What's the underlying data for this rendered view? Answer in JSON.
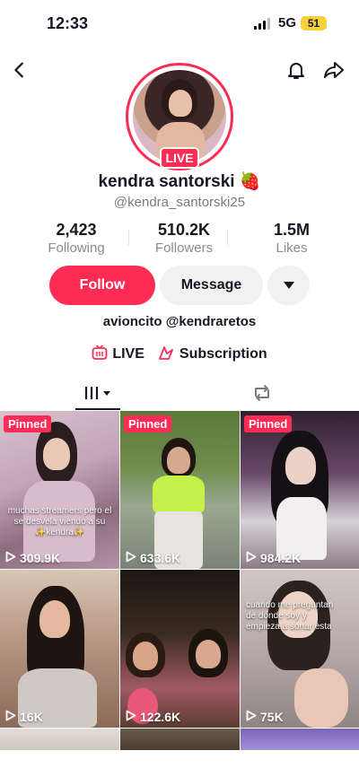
{
  "status_bar": {
    "time": "12:33",
    "network": "5G",
    "battery": "51"
  },
  "profile": {
    "display_name": "kendra santorski 🍓",
    "handle": "@kendra_santorski25",
    "live_badge": "LIVE",
    "bio": "avioncito @kendraretos"
  },
  "stats": [
    {
      "value": "2,423",
      "label": "Following"
    },
    {
      "value": "510.2K",
      "label": "Followers"
    },
    {
      "value": "1.5M",
      "label": "Likes"
    }
  ],
  "actions": {
    "follow": "Follow",
    "message": "Message"
  },
  "links": {
    "live": "LIVE",
    "subscription": "Subscription"
  },
  "videos": [
    {
      "pinned": "Pinned",
      "views": "309.9K",
      "caption": "muchas streamers pero el se desvela viendo a su ✨kendra✨"
    },
    {
      "pinned": "Pinned",
      "views": "633.6K"
    },
    {
      "pinned": "Pinned",
      "views": "984.2K"
    },
    {
      "views": "16K"
    },
    {
      "views": "122.6K"
    },
    {
      "views": "75K",
      "caption": "cuando me preguntan de dónde soy y empieza a sonar esta"
    }
  ],
  "colors": {
    "accent": "#fe2c55",
    "text": "#161823",
    "muted": "#8a8b91"
  }
}
